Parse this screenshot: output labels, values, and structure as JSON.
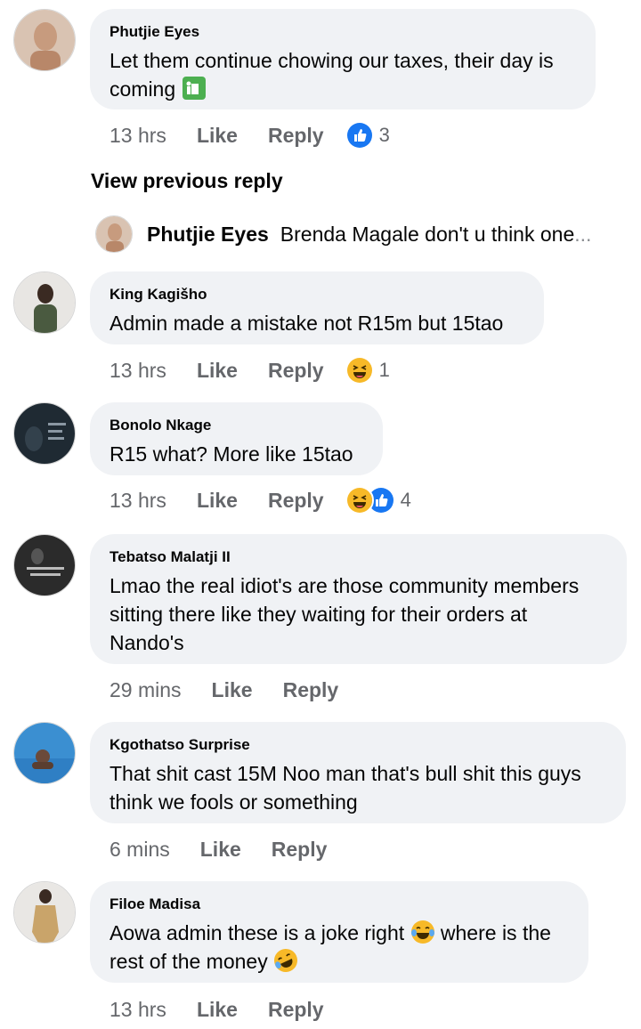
{
  "comments": [
    {
      "author": "Phutjie Eyes",
      "text": "Let them continue chowing our taxes, their day is",
      "text2": "coming",
      "time": "13 hrs",
      "like": "Like",
      "reply": "Reply",
      "reaction_count": "3"
    },
    {
      "author": "King Kagišho",
      "text": "Admin made a mistake not R15m but 15tao",
      "time": "13 hrs",
      "like": "Like",
      "reply": "Reply",
      "reaction_count": "1"
    },
    {
      "author": "Bonolo Nkage",
      "text": "R15 what? More like 15tao",
      "time": "13 hrs",
      "like": "Like",
      "reply": "Reply",
      "reaction_count": "4"
    },
    {
      "author": "Tebatso Malatji II",
      "text": "Lmao the real idiot's are those community members sitting there like they waiting for their  orders at Nando's",
      "time": "29 mins",
      "like": "Like",
      "reply": "Reply"
    },
    {
      "author": "Kgothatso Surprise",
      "text": "That shit cast 15M Noo man that's bull shit this guys think we fools or something",
      "time": "6 mins",
      "like": "Like",
      "reply": "Reply"
    },
    {
      "author": "Filoe Madisa",
      "text_a": "Aowa admin these is a joke right",
      "text_b": "where is the",
      "text_c": "rest of the money",
      "time": "13 hrs",
      "like": "Like",
      "reply": "Reply"
    }
  ],
  "view_previous": "View previous reply",
  "reply_preview": {
    "author": "Phutjie Eyes",
    "text": "Brenda Magale don't u think one",
    "ellipsis": "..."
  },
  "icons": {
    "like_reaction": "thumbs-up-icon",
    "haha_reaction": "laughing-face-icon",
    "recycle_emoji": "recycling-bin-emoji",
    "tears_emoji": "tears-of-joy-emoji",
    "rofl_emoji": "rolling-laughing-emoji"
  },
  "colors": {
    "bubble": "#f0f2f5",
    "meta": "#65676b",
    "like_blue": "#1877f2",
    "haha_yellow": "#f7b928"
  }
}
